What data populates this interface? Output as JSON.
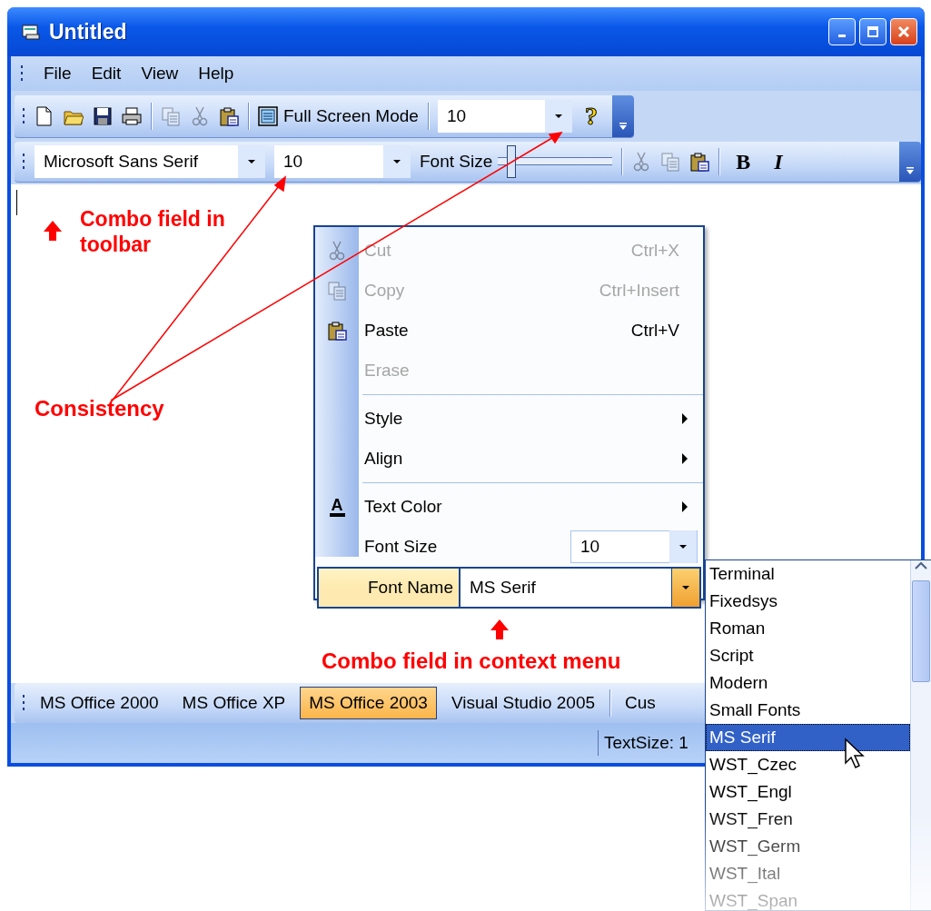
{
  "window": {
    "title": "Untitled"
  },
  "menu_bar": [
    {
      "label": "File"
    },
    {
      "label": "Edit"
    },
    {
      "label": "View"
    },
    {
      "label": "Help"
    }
  ],
  "main_toolbar": [
    {
      "kind": "icon",
      "disabled": false
    },
    {
      "kind": "icon",
      "disabled": false
    },
    {
      "kind": "icon",
      "disabled": false
    },
    {
      "kind": "icon",
      "disabled": false
    },
    {
      "kind": "separator"
    },
    {
      "kind": "icon",
      "disabled": true
    },
    {
      "kind": "icon",
      "disabled": true
    },
    {
      "kind": "icon",
      "disabled": false
    },
    {
      "kind": "separator"
    },
    {
      "kind": "text_button",
      "label": "Full Screen Mode"
    },
    {
      "kind": "separator"
    },
    {
      "kind": "combo",
      "value": "10"
    },
    {
      "kind": "help",
      "label": "?"
    }
  ],
  "format_toolbar": [
    {
      "kind": "combo",
      "value": "Microsoft Sans Serif"
    },
    {
      "kind": "combo",
      "value": "10"
    },
    {
      "kind": "label",
      "label": "Font Size"
    },
    {
      "kind": "slider",
      "level": 0.08
    },
    {
      "kind": "separator"
    },
    {
      "kind": "icon",
      "disabled": true
    },
    {
      "kind": "icon",
      "disabled": true
    },
    {
      "kind": "icon",
      "disabled": false
    },
    {
      "kind": "separator"
    },
    {
      "kind": "glyph",
      "label": "B"
    },
    {
      "kind": "glyph",
      "label": "I"
    }
  ],
  "context_menu": [
    {
      "kind": "item",
      "label": "Cut",
      "shortcut": "Ctrl+X",
      "disabled": true,
      "submenu": false
    },
    {
      "kind": "item",
      "label": "Copy",
      "shortcut": "Ctrl+Insert",
      "disabled": true,
      "submenu": false
    },
    {
      "kind": "item",
      "label": "Paste",
      "shortcut": "Ctrl+V",
      "disabled": false,
      "submenu": false
    },
    {
      "kind": "item",
      "label": "Erase",
      "disabled": true,
      "submenu": false
    },
    {
      "kind": "separator"
    },
    {
      "kind": "item",
      "label": "Style",
      "disabled": false,
      "submenu": true
    },
    {
      "kind": "item",
      "label": "Align",
      "disabled": false,
      "submenu": true
    },
    {
      "kind": "separator"
    },
    {
      "kind": "item",
      "label": "Text Color",
      "icon_text": "A",
      "disabled": false,
      "submenu": true
    },
    {
      "kind": "combo",
      "label": "Font Size",
      "value": "10",
      "selected": false
    },
    {
      "kind": "combo",
      "label": "Font Name",
      "value": "MS Serif",
      "selected": true
    }
  ],
  "font_list": [
    {
      "label": "Terminal",
      "selected": false
    },
    {
      "label": "Fixedsys",
      "selected": false
    },
    {
      "label": "Roman",
      "selected": false
    },
    {
      "label": "Script",
      "selected": false
    },
    {
      "label": "Modern",
      "selected": false
    },
    {
      "label": "Small Fonts",
      "selected": false
    },
    {
      "label": "MS Serif",
      "selected": true
    },
    {
      "label": "WST_Czec",
      "selected": false
    },
    {
      "label": "WST_Engl",
      "selected": false
    },
    {
      "label": "WST_Fren",
      "selected": false
    },
    {
      "label": "WST_Germ",
      "selected": false
    },
    {
      "label": "WST_Ital",
      "selected": false
    },
    {
      "label": "WST_Span",
      "selected": false
    }
  ],
  "theme_toolbar": [
    {
      "kind": "theme",
      "label": "MS Office 2000",
      "selected": false
    },
    {
      "kind": "theme",
      "label": "MS Office XP",
      "selected": false
    },
    {
      "kind": "theme",
      "label": "MS Office 2003",
      "selected": true
    },
    {
      "kind": "theme",
      "label": "Visual Studio 2005",
      "selected": false
    },
    {
      "kind": "separator"
    },
    {
      "kind": "theme",
      "label": "Cus",
      "selected": false
    }
  ],
  "status_bar": {
    "text": "TextSize: 1"
  },
  "annotations": [
    {
      "text": "Combo field in toolbar"
    },
    {
      "text": "Consistency"
    },
    {
      "text": "Combo field in context menu"
    }
  ]
}
